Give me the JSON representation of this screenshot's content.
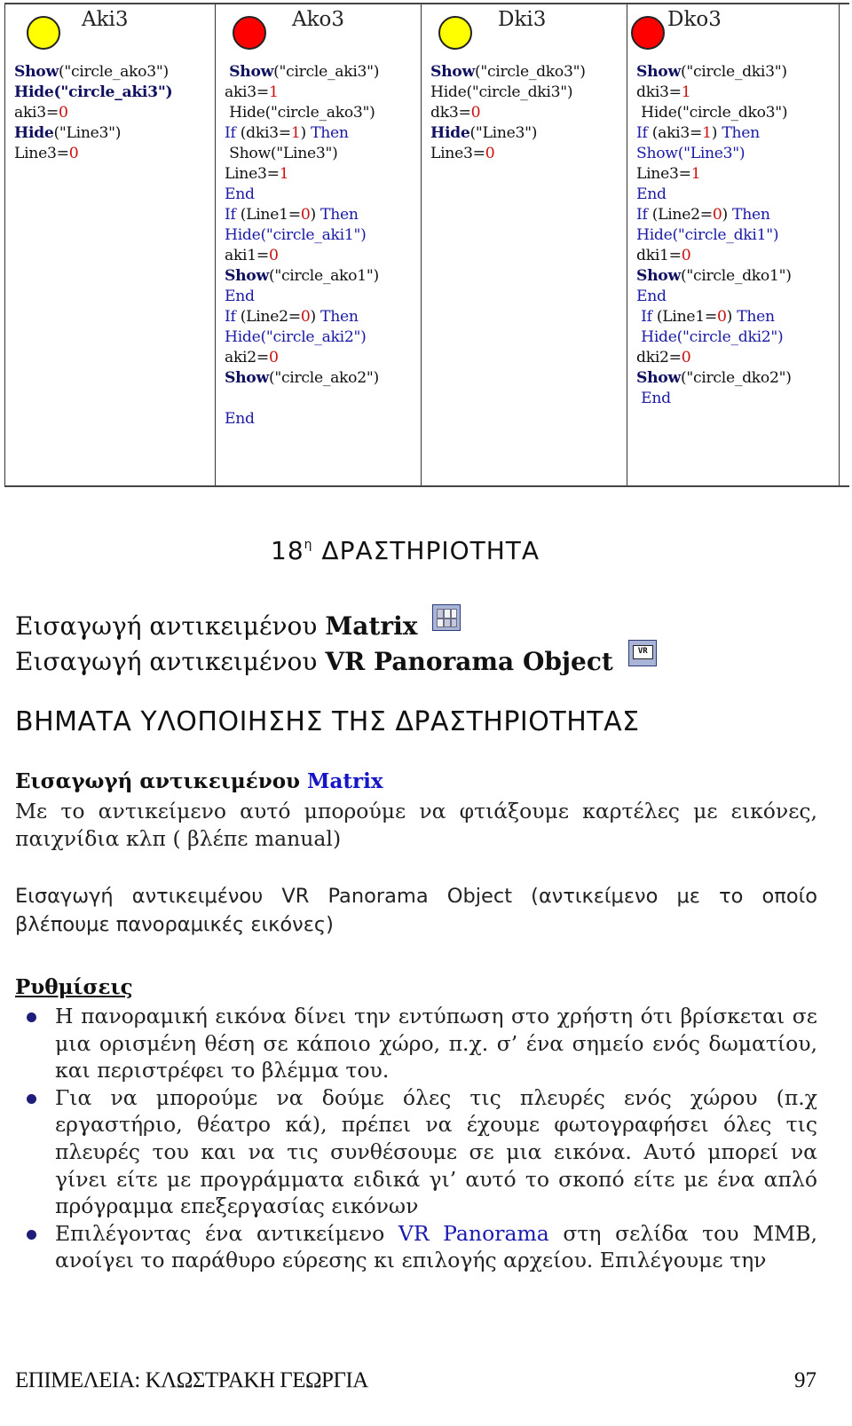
{
  "table": {
    "columns": [
      {
        "title": "Aki3",
        "circle_color": "yellow",
        "lines": [
          [
            [
              "kwb",
              "Show"
            ],
            [
              "blk",
              "(\"circle_ako3\")"
            ]
          ],
          [
            [
              "kwb",
              "Hide(\"circle_aki3\")"
            ]
          ],
          [
            [
              "blk",
              "aki3="
            ],
            [
              "num",
              "0"
            ]
          ],
          [
            [
              "kwb",
              "Hide"
            ],
            [
              "blk",
              "(\"Line3\")"
            ]
          ],
          [
            [
              "blk",
              "Line3="
            ],
            [
              "num",
              "0"
            ]
          ]
        ]
      },
      {
        "title": "Ako3",
        "circle_color": "red",
        "lines": [
          [
            [
              "blk",
              " "
            ],
            [
              "kwb",
              "Show"
            ],
            [
              "blk",
              "(\"circle_aki3\")"
            ]
          ],
          [
            [
              "blk",
              "aki3="
            ],
            [
              "num",
              "1"
            ]
          ],
          [
            [
              "blk",
              " Hide(\"circle_ako3\")"
            ]
          ],
          [
            [
              "kw",
              "If "
            ],
            [
              "blk",
              "(dki3="
            ],
            [
              "num",
              "1"
            ],
            [
              "blk",
              ") "
            ],
            [
              "kw",
              "Then"
            ]
          ],
          [
            [
              "blk",
              " Show(\"Line3\")"
            ]
          ],
          [
            [
              "blk",
              "Line3="
            ],
            [
              "num",
              "1"
            ]
          ],
          [
            [
              "kw",
              "End"
            ]
          ],
          [
            [
              "kw",
              "If "
            ],
            [
              "blk",
              "(Line1="
            ],
            [
              "num",
              "0"
            ],
            [
              "blk",
              ") "
            ],
            [
              "kw",
              "Then"
            ]
          ],
          [
            [
              "kw",
              "Hide(\"circle_aki1\")"
            ]
          ],
          [
            [
              "blk",
              "aki1="
            ],
            [
              "num",
              "0"
            ]
          ],
          [
            [
              "kwb",
              "Show"
            ],
            [
              "blk",
              "(\"circle_ako1\")"
            ]
          ],
          [
            [
              "kw",
              "End"
            ]
          ],
          [
            [
              "kw",
              "If "
            ],
            [
              "blk",
              "(Line2="
            ],
            [
              "num",
              "0"
            ],
            [
              "blk",
              ") "
            ],
            [
              "kw",
              "Then"
            ]
          ],
          [
            [
              "kw",
              "Hide(\"circle_aki2\")"
            ]
          ],
          [
            [
              "blk",
              "aki2="
            ],
            [
              "num",
              "0"
            ]
          ],
          [
            [
              "kwb",
              "Show"
            ],
            [
              "blk",
              "(\"circle_ako2\")"
            ]
          ],
          [],
          [
            [
              "kw",
              "End"
            ]
          ]
        ]
      },
      {
        "title": "Dki3",
        "circle_color": "yellow",
        "lines": [
          [
            [
              "kwb",
              "Show"
            ],
            [
              "blk",
              "(\"circle_dko3\")"
            ]
          ],
          [
            [
              "blk",
              "Hide(\"circle_dki3\")"
            ]
          ],
          [
            [
              "blk",
              "dk3="
            ],
            [
              "num",
              "0"
            ]
          ],
          [
            [
              "kwb",
              "Hide"
            ],
            [
              "blk",
              "(\"Line3\")"
            ]
          ],
          [
            [
              "blk",
              "Line3="
            ],
            [
              "num",
              "0"
            ]
          ]
        ]
      },
      {
        "title": "Dko3",
        "circle_color": "red",
        "lines": [
          [
            [
              "kwb",
              "Show"
            ],
            [
              "blk",
              "(\"circle_dki3\")"
            ]
          ],
          [
            [
              "blk",
              "dki3="
            ],
            [
              "num",
              "1"
            ]
          ],
          [
            [
              "blk",
              " Hide(\"circle_dko3\")"
            ]
          ],
          [
            [
              "kw",
              "If "
            ],
            [
              "blk",
              "(aki3="
            ],
            [
              "num",
              "1"
            ],
            [
              "blk",
              ") "
            ],
            [
              "kw",
              "Then"
            ]
          ],
          [
            [
              "kw",
              "Show(\"Line3\")"
            ]
          ],
          [
            [
              "blk",
              "Line3="
            ],
            [
              "num",
              "1"
            ]
          ],
          [
            [
              "kw",
              "End"
            ]
          ],
          [
            [
              "kw",
              "If "
            ],
            [
              "blk",
              "(Line2="
            ],
            [
              "num",
              "0"
            ],
            [
              "blk",
              ") "
            ],
            [
              "kw",
              "Then"
            ]
          ],
          [
            [
              "kw",
              "Hide(\"circle_dki1\")"
            ]
          ],
          [
            [
              "blk",
              "dki1="
            ],
            [
              "num",
              "0"
            ]
          ],
          [
            [
              "kwb",
              "Show"
            ],
            [
              "blk",
              "(\"circle_dko1\")"
            ]
          ],
          [
            [
              "kw",
              "End"
            ]
          ],
          [
            [
              "kw",
              " If "
            ],
            [
              "blk",
              "(Line1="
            ],
            [
              "num",
              "0"
            ],
            [
              "blk",
              ") "
            ],
            [
              "kw",
              "Then"
            ]
          ],
          [
            [
              "kw",
              " Hide(\"circle_dki2\")"
            ]
          ],
          [
            [
              "blk",
              "dki2="
            ],
            [
              "num",
              "0"
            ]
          ],
          [
            [
              "kwb",
              "Show"
            ],
            [
              "blk",
              "(\"circle_dko2\")"
            ]
          ],
          [
            [
              "kw",
              " End"
            ]
          ]
        ]
      }
    ]
  },
  "activity": {
    "number": "18",
    "superscript": "η",
    "title": "ΔΡΑΣΤΗΡΙΟΤΗΤΑ"
  },
  "inserts": [
    {
      "prefix": "Εισαγωγή αντικειμένου ",
      "object": "Matrix",
      "icon": "matrix-icon"
    },
    {
      "prefix": "Εισαγωγή αντικειμένου ",
      "object": "VR Panorama Object",
      "icon": "vr-panorama-icon",
      "icon_label": "VR"
    }
  ],
  "steps_title": "ΒΗΜΑΤΑ ΥΛΟΠΟΙΗΣΗΣ ΤΗΣ ΔΡΑΣΤΗΡΙΟΤΗΤΑΣ",
  "matrix_section": {
    "heading_prefix": "Εισαγωγή αντικειμένου ",
    "heading_object": "Matrix",
    "text": "Με το αντικείμενο αυτό μπορούμε να φτιάξουμε καρτέλες με εικόνες, παιχνίδια κλπ ( βλέπε manual)"
  },
  "vr_section": {
    "text": "Εισαγωγή αντικειμένου VR Panorama Object (αντικείμενο με το οποίο βλέπουμε πανοραμικές εικόνες)"
  },
  "settings": {
    "heading": "Ρυθμίσεις",
    "bullets": [
      {
        "text": "Η πανοραμική εικόνα δίνει την εντύπωση στο χρήστη ότι βρίσκεται σε μια ορισμένη θέση σε κάποιο χώρο, π.χ. σ’ ένα σημείο ενός δωματίου, και περιστρέφει το βλέμμα του."
      },
      {
        "text": "Για να μπορούμε να δούμε όλες τις πλευρές ενός χώρου (π.χ εργαστήριο, θέατρο κά), πρέπει να έχουμε φωτογραφήσει όλες τις πλευρές του και να τις συνθέσουμε σε μια εικόνα. Αυτό μπορεί να γίνει είτε με προγράμματα ειδικά γι’ αυτό το σκοπό είτε με ένα απλό πρόγραμμα επεξεργασίας εικόνων"
      },
      {
        "before": "Επιλέγοντας ένα αντικείμενο ",
        "highlight": "VR Panorama",
        "after": " στη σελίδα του ΜΜΒ, ανοίγει  το παράθυρο εύρεσης κι επιλογής αρχείου.  Επιλέγουμε την"
      }
    ]
  },
  "footer": {
    "author": "ΕΠΙΜΕΛΕΙΑ: ΚΛΩΣΤΡΑΚΗ ΓΕΩΡΓΙΑ",
    "page_number": "97"
  },
  "colors": {
    "keyword_blue": "#1a1aa6",
    "keyword_bold_navy": "#101060",
    "number_red": "#cc1111",
    "circle_yellow": "#ffff00",
    "circle_red": "#ff0000"
  }
}
